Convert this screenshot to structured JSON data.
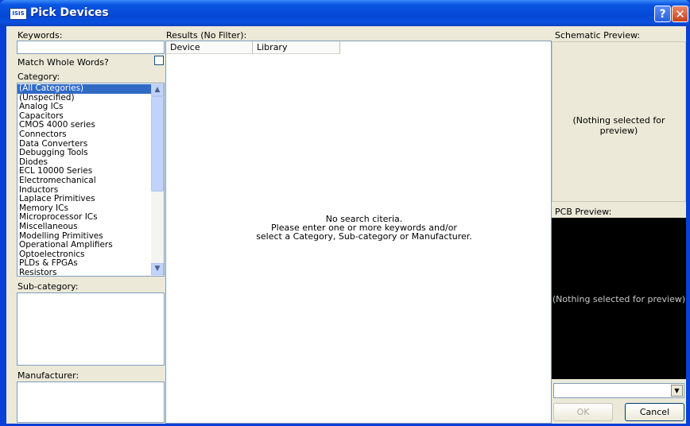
{
  "window": {
    "title": "Pick Devices",
    "app_icon_text": "ISIS"
  },
  "left": {
    "keywords_label": "Keywords:",
    "keywords_value": "",
    "match_whole_words_label": "Match Whole Words?",
    "category_label": "Category:",
    "categories": [
      "(All Categories)",
      "(Unspecified)",
      "Analog ICs",
      "Capacitors",
      "CMOS 4000 series",
      "Connectors",
      "Data Converters",
      "Debugging Tools",
      "Diodes",
      "ECL 10000 Series",
      "Electromechanical",
      "Inductors",
      "Laplace Primitives",
      "Memory ICs",
      "Microprocessor ICs",
      "Miscellaneous",
      "Modelling Primitives",
      "Operational Amplifiers",
      "Optoelectronics",
      "PLDs & FPGAs",
      "Resistors"
    ],
    "selected_category": "(All Categories)",
    "subcategory_label": "Sub-category:",
    "manufacturer_label": "Manufacturer:"
  },
  "results": {
    "label": "Results (No Filter):",
    "columns": [
      "Device",
      "Library"
    ],
    "empty_message_line1": "No search citeria.",
    "empty_message_line2": "Please enter one or more keywords and/or",
    "empty_message_line3": "select a Category, Sub-category or Manufacturer."
  },
  "right": {
    "schematic_label": "Schematic Preview:",
    "schematic_empty": "(Nothing selected for preview)",
    "pcb_label": "PCB Preview:",
    "pcb_empty": "(Nothing selected for preview)",
    "package_value": "",
    "ok_label": "OK",
    "cancel_label": "Cancel"
  },
  "icons": {
    "help": "help-icon",
    "close": "close-icon",
    "scroll_up": "chevron-up-icon",
    "scroll_down": "chevron-down-icon",
    "dropdown": "triangle-down-icon"
  }
}
